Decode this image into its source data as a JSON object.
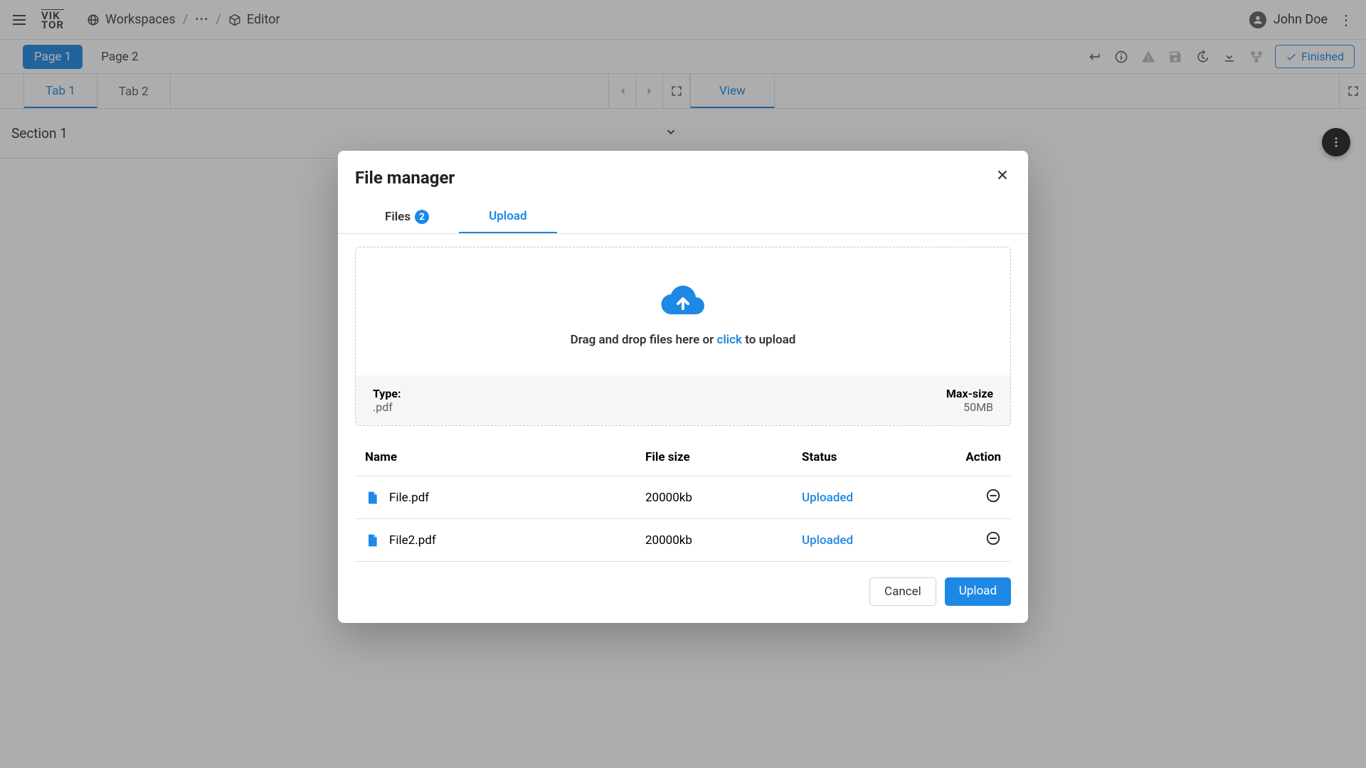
{
  "header": {
    "logo_lines": [
      "VIK",
      "TOR"
    ],
    "breadcrumbs": {
      "workspaces": "Workspaces",
      "editor": "Editor"
    },
    "user_name": "John Doe"
  },
  "pages": {
    "page1": "Page 1",
    "page2": "Page 2",
    "finished": "Finished"
  },
  "input_panel": {
    "tab1": "Tab 1",
    "tab2": "Tab 2",
    "section1": "Section 1"
  },
  "view_panel": {
    "view": "View"
  },
  "modal": {
    "title": "File manager",
    "tabs": {
      "files": "Files",
      "files_count": "2",
      "upload": "Upload"
    },
    "dropzone": {
      "text_before": "Drag and drop files here or ",
      "link": "click",
      "text_after": " to upload",
      "type_label": "Type:",
      "type_value": ".pdf",
      "max_label": "Max-size",
      "max_value": "50MB"
    },
    "table": {
      "head_name": "Name",
      "head_size": "File size",
      "head_status": "Status",
      "head_action": "Action",
      "rows": [
        {
          "name": "File.pdf",
          "size": "20000kb",
          "status": "Uploaded"
        },
        {
          "name": "File2.pdf",
          "size": "20000kb",
          "status": "Uploaded"
        }
      ]
    },
    "footer": {
      "cancel": "Cancel",
      "upload": "Upload"
    }
  }
}
